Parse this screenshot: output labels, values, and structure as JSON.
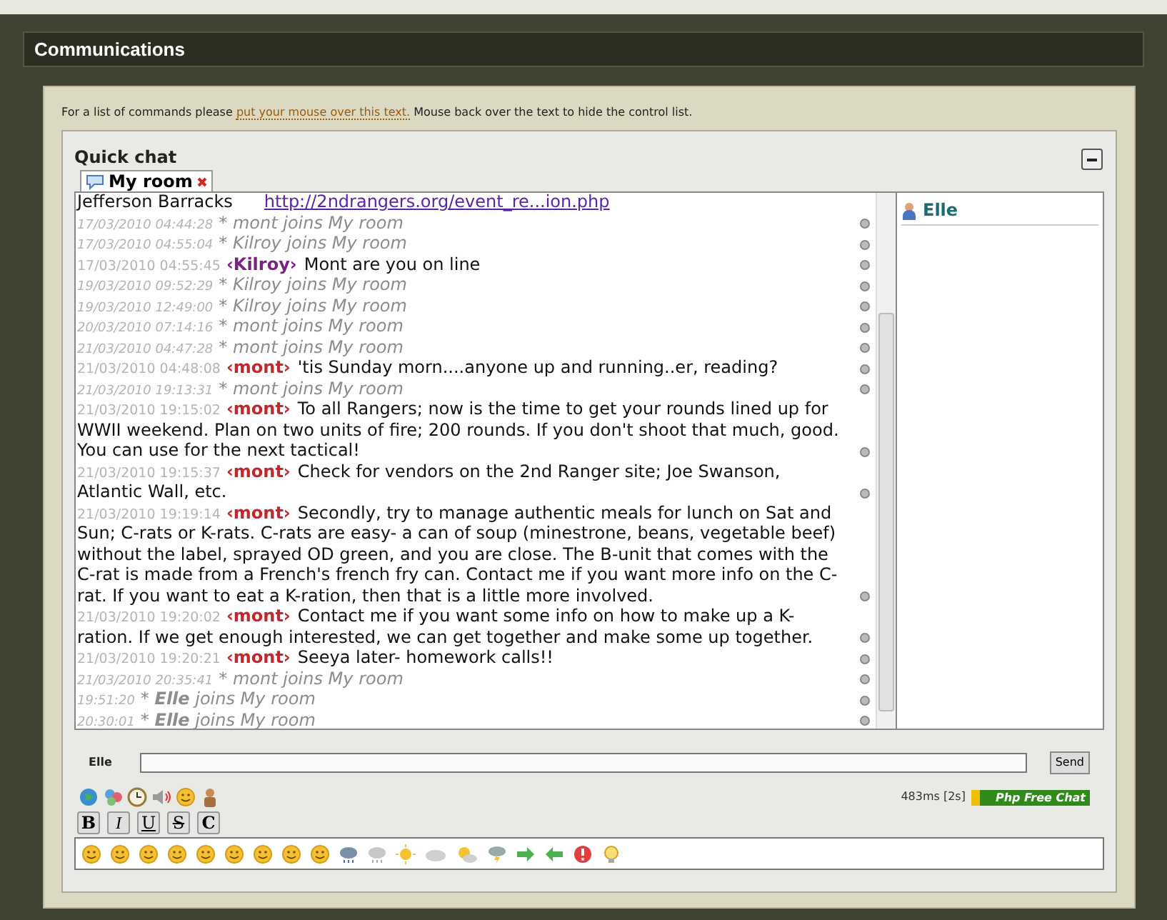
{
  "header": {
    "title": "Communications"
  },
  "help": {
    "before": "For a list of commands please",
    "link": "put your mouse over this text.",
    "after": "Mouse back over the text to hide the control list."
  },
  "chat": {
    "title": "Quick chat",
    "tabs": [
      {
        "label": "My room",
        "selected": true
      }
    ],
    "messages": [
      {
        "kind": "fragment",
        "text": "Jefferson Barracks",
        "link": "http://2ndrangers.org/event_re...ion.php"
      },
      {
        "kind": "join",
        "time": "17/03/2010 04:44:28",
        "text": "* mont joins My room"
      },
      {
        "kind": "join",
        "time": "17/03/2010 04:55:04",
        "text": "* Kilroy joins My room"
      },
      {
        "kind": "msg",
        "time": "17/03/2010 04:55:45",
        "nick": "‹Kilroy›",
        "color": "#7a2282",
        "text": "Mont are you on line"
      },
      {
        "kind": "join",
        "time": "19/03/2010 09:52:29",
        "text": "* Kilroy joins My room"
      },
      {
        "kind": "join",
        "time": "19/03/2010 12:49:00",
        "text": "* Kilroy joins My room"
      },
      {
        "kind": "join",
        "time": "20/03/2010 07:14:16",
        "text": "* mont joins My room"
      },
      {
        "kind": "join",
        "time": "21/03/2010 04:47:28",
        "text": "* mont joins My room"
      },
      {
        "kind": "msg",
        "time": "21/03/2010 04:48:08",
        "nick": "‹mont›",
        "color": "#c4262c",
        "text": "'tis Sunday morn....anyone up and running..er, reading?"
      },
      {
        "kind": "join",
        "time": "21/03/2010 19:13:31",
        "text": "* mont joins My room"
      },
      {
        "kind": "msg",
        "time": "21/03/2010 19:15:02",
        "nick": "‹mont›",
        "color": "#c4262c",
        "text": "To all Rangers; now is the time to get your rounds lined up for WWII weekend. Plan on two units of fire; 200 rounds. If you don't shoot that much, good. You can use for the next tactical!"
      },
      {
        "kind": "msg",
        "time": "21/03/2010 19:15:37",
        "nick": "‹mont›",
        "color": "#c4262c",
        "text": "Check for vendors on the 2nd Ranger site; Joe Swanson, Atlantic Wall, etc."
      },
      {
        "kind": "msg",
        "time": "21/03/2010 19:19:14",
        "nick": "‹mont›",
        "color": "#c4262c",
        "text": "Secondly, try to manage authentic meals for lunch on Sat and Sun; C-rats or K-rats. C-rats are easy- a can of soup (minestrone, beans, vegetable beef) without the label, sprayed OD green, and you are close. The B-unit that comes with the C-rat is made from a French's french fry can. Contact me if you want more info on the C-rat. If you want to eat a K-ration, then that is a little more involved."
      },
      {
        "kind": "msg",
        "time": "21/03/2010 19:20:02",
        "nick": "‹mont›",
        "color": "#c4262c",
        "text": "Contact me if you want some info on how to make up a K-ration. If we get enough interested, we can get together and make some up together."
      },
      {
        "kind": "msg",
        "time": "21/03/2010 19:20:21",
        "nick": "‹mont›",
        "color": "#c4262c",
        "text": "Seeya later- homework calls!!"
      },
      {
        "kind": "join",
        "time": "21/03/2010 20:35:41",
        "text": "* mont joins My room"
      },
      {
        "kind": "join",
        "time": "19:51:20",
        "text": "* **Elle** joins My room"
      },
      {
        "kind": "join",
        "time": "20:30:01",
        "text": "* **Elle** joins My room"
      }
    ],
    "users": [
      {
        "name": "Elle"
      }
    ]
  },
  "input": {
    "nick": "Elle",
    "send": "Send"
  },
  "status": {
    "ping": "483ms [2s]",
    "badge": "Php Free Chat"
  },
  "format_buttons": [
    {
      "kind": "bold",
      "label": "B"
    },
    {
      "kind": "italic",
      "label": "I"
    },
    {
      "kind": "underline",
      "label": "U"
    },
    {
      "kind": "strike",
      "label": "S"
    },
    {
      "kind": "color",
      "label": "C"
    }
  ]
}
